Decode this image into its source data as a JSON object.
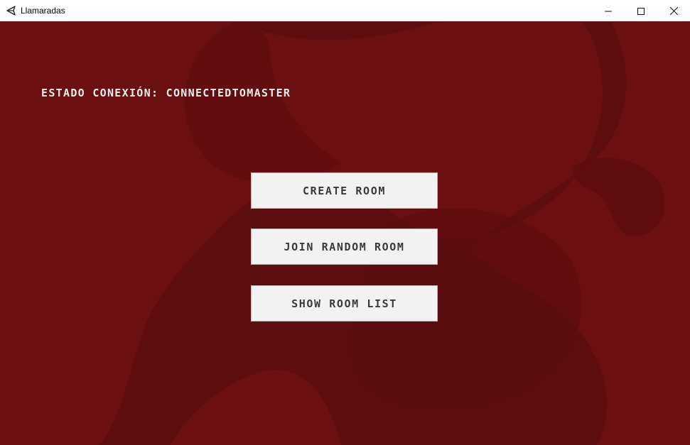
{
  "window": {
    "title": "Llamaradas",
    "app_icon": "unity-icon",
    "controls": {
      "minimize_icon": "minimize-icon",
      "maximize_icon": "maximize-icon",
      "close_icon": "close-icon"
    }
  },
  "game": {
    "status_text": "ESTADO CONEXIóN: CONNECTEDTOMASTER",
    "buttons": {
      "create_room": "CREATE ROOM",
      "join_random_room": "JOIN RANDOM ROOM",
      "show_room_list": "SHOW ROOM LIST"
    }
  },
  "colors": {
    "background": "#6b1012",
    "background_shape": "#5a0d10",
    "button_background": "#f2f2f2",
    "button_text": "#3a3a3a",
    "status_text": "#f2eeee"
  }
}
